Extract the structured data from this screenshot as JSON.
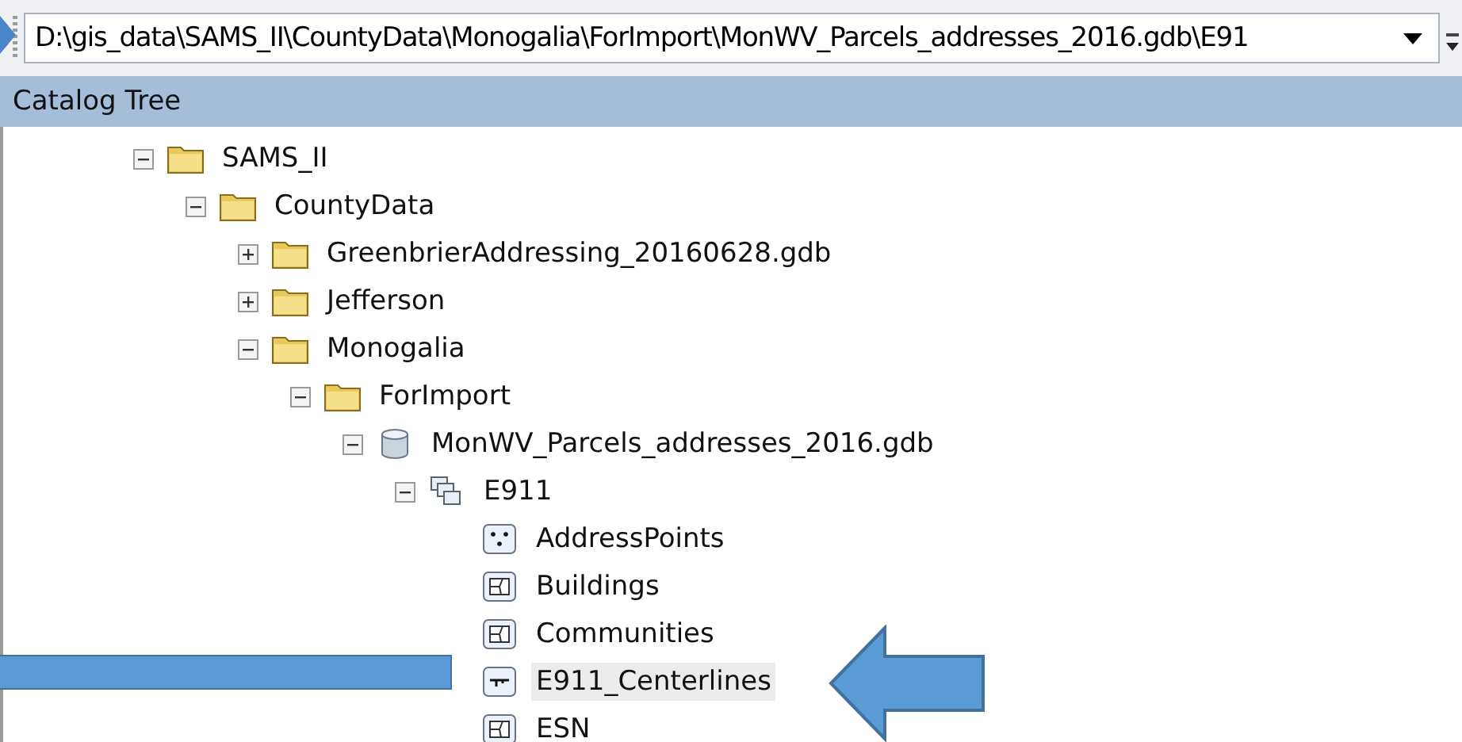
{
  "address_bar": {
    "value": "D:\\gis_data\\SAMS_II\\CountyData\\Monogalia\\ForImport\\MonWV_Parcels_addresses_2016.gdb\\E91"
  },
  "panel": {
    "title": "Catalog Tree"
  },
  "tree": [
    {
      "label": "SAMS_II",
      "kind": "folder",
      "expanded": true,
      "selected": false,
      "children": [
        {
          "label": "CountyData",
          "kind": "folder",
          "expanded": true,
          "selected": false,
          "children": [
            {
              "label": "GreenbrierAddressing_20160628.gdb",
              "kind": "folder",
              "expanded": false,
              "selected": false
            },
            {
              "label": "Jefferson",
              "kind": "folder",
              "expanded": false,
              "selected": false
            },
            {
              "label": "Monogalia",
              "kind": "folder",
              "expanded": true,
              "selected": false,
              "children": [
                {
                  "label": "ForImport",
                  "kind": "folder",
                  "expanded": true,
                  "selected": false,
                  "children": [
                    {
                      "label": "MonWV_Parcels_addresses_2016.gdb",
                      "kind": "geodatabase",
                      "expanded": true,
                      "selected": false,
                      "children": [
                        {
                          "label": "E911",
                          "kind": "dataset",
                          "expanded": true,
                          "selected": false,
                          "children": [
                            {
                              "label": "AddressPoints",
                              "kind": "point",
                              "selected": false
                            },
                            {
                              "label": "Buildings",
                              "kind": "polygon",
                              "selected": false
                            },
                            {
                              "label": "Communities",
                              "kind": "polygon",
                              "selected": false
                            },
                            {
                              "label": "E911_Centerlines",
                              "kind": "line",
                              "selected": true
                            },
                            {
                              "label": "ESN",
                              "kind": "polygon",
                              "selected": false
                            }
                          ]
                        }
                      ]
                    }
                  ]
                }
              ]
            }
          ]
        }
      ]
    }
  ]
}
